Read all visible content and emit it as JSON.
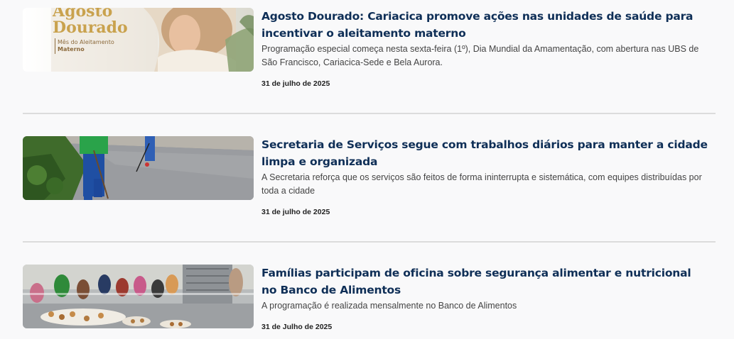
{
  "news": [
    {
      "title": "Agosto Dourado: Cariacica promove ações nas unidades de saúde para incentivar o aleitamento materno",
      "summary": "Programação especial começa nesta sexta-feira (1º), Dia Mundial da Amamentação, com abertura nas UBS de São Francisco, Cariacica-Sede e Bela Aurora.",
      "date": "31 de julho de 2025",
      "image_text": {
        "line1": "Agosto",
        "line2": "Dourado",
        "line3": "Mês do Aleitamento",
        "line4": "Materno"
      }
    },
    {
      "title": "Secretaria de Serviços segue com trabalhos diários para manter a cidade limpa e organizada",
      "summary": "A Secretaria reforça que os serviços são feitos de forma ininterrupta e sistemática, com equipes distribuídas por toda a cidade",
      "date": "31 de julho de 2025"
    },
    {
      "title": "Famílias participam de oficina sobre segurança alimentar e nutricional no Banco de Alimentos",
      "summary": "A programação é realizada mensalmente no Banco de Alimentos",
      "date": "31 de Julho de 2025"
    }
  ]
}
